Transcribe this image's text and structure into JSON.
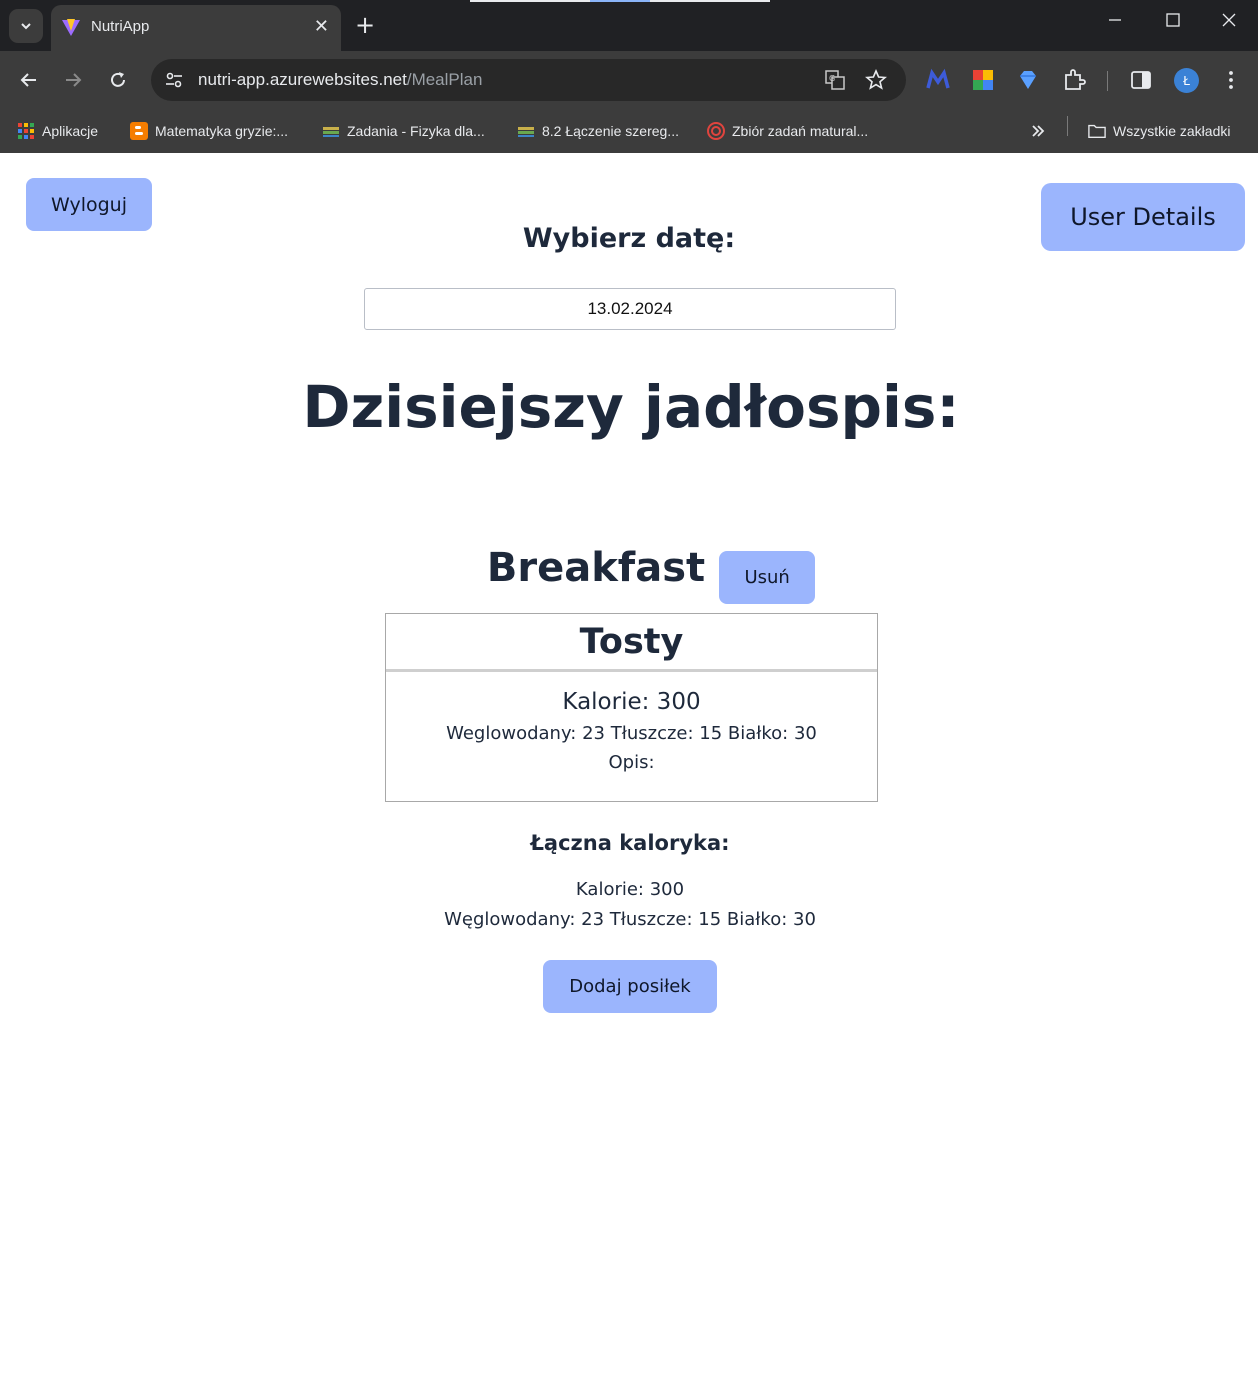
{
  "browser": {
    "tab_title": "NutriApp",
    "url_host": "nutri-app.azurewebsites.net",
    "url_path": "/MealPlan",
    "bookmarks": [
      {
        "label": "Aplikacje",
        "icon": "apps-grid-icon"
      },
      {
        "label": "Matematyka gryzie:...",
        "icon": "blogger-icon"
      },
      {
        "label": "Zadania - Fizyka dla...",
        "icon": "books-icon"
      },
      {
        "label": "8.2 Łączenie szereg...",
        "icon": "books-icon"
      },
      {
        "label": "Zbiór zadań matural...",
        "icon": "target-icon"
      }
    ],
    "all_bookmarks_label": "Wszystkie zakładki",
    "profile_initial": "Ł"
  },
  "page": {
    "logout_label": "Wyloguj",
    "user_details_label": "User Details",
    "date_label": "Wybierz datę:",
    "date_value": "13.02.2024",
    "title": "Dzisiejszy jadłospis:",
    "meals": [
      {
        "type": "Breakfast",
        "delete_label": "Usuń",
        "name": "Tosty",
        "calories_text": "Kalorie: 300",
        "macros_text": "Weglowodany: 23 Tłuszcze: 15 Białko: 30",
        "description_text": "Opis:"
      }
    ],
    "total_title": "Łączna kaloryka:",
    "total_calories_text": "Kalorie: 300",
    "total_macros_text": "Węglowodany: 23 Tłuszcze: 15 Białko: 30",
    "add_meal_label": "Dodaj posiłek"
  },
  "colors": {
    "button_bg": "#9bb5fd",
    "text_dark": "#1e293b",
    "chrome_bg": "#3c3c3c",
    "tabstrip_bg": "#202124"
  }
}
